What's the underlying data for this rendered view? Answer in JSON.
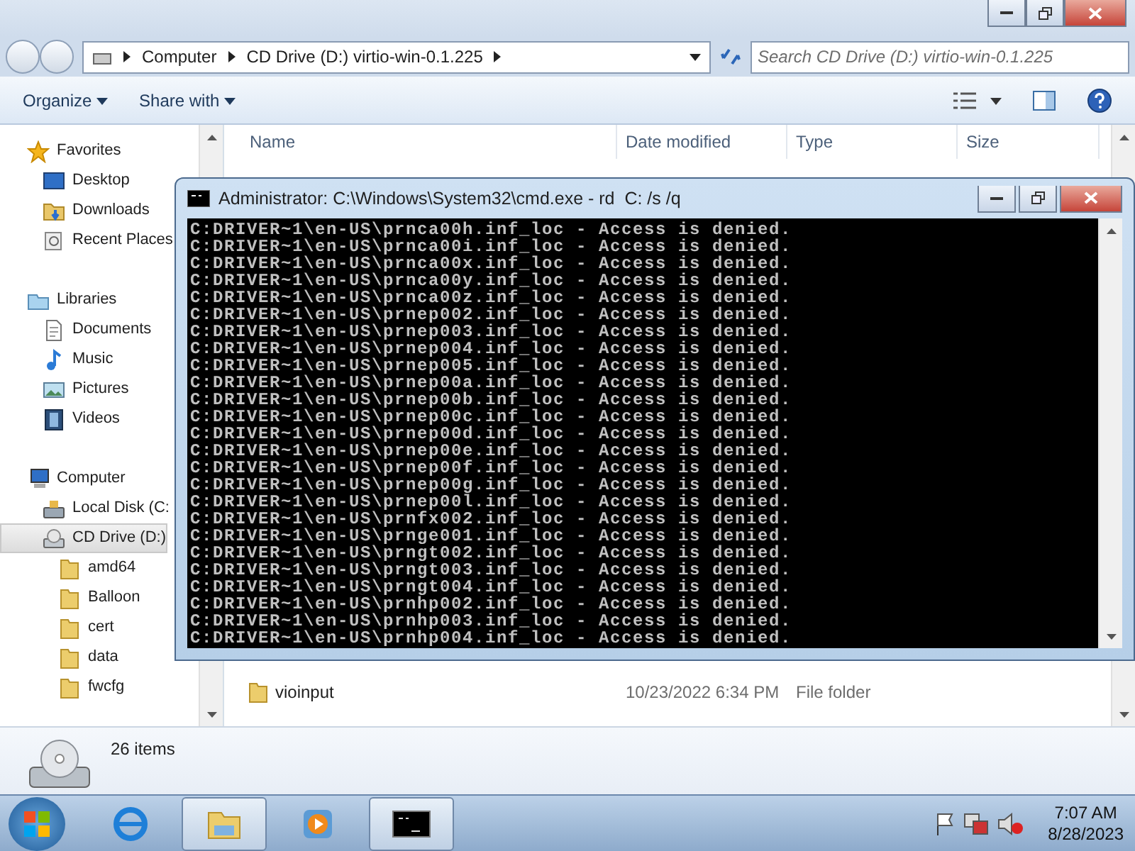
{
  "address_bar": {
    "segments": [
      "Computer",
      "CD Drive (D:) virtio-win-0.1.225"
    ]
  },
  "search": {
    "placeholder": "Search CD Drive (D:) virtio-win-0.1.225"
  },
  "toolbar": {
    "menus": [
      "Organize",
      "Share with"
    ]
  },
  "navigation": {
    "items": [
      {
        "label": "Favorites",
        "kind": "star",
        "selected": false,
        "children": [
          {
            "label": "Desktop",
            "kind": "desktop",
            "selected": false
          },
          {
            "label": "Downloads",
            "kind": "downloads",
            "selected": false
          },
          {
            "label": "Recent Places",
            "kind": "recent",
            "selected": false
          }
        ]
      },
      {
        "label": "Libraries",
        "kind": "library",
        "selected": false,
        "children": [
          {
            "label": "Documents",
            "kind": "document",
            "selected": false
          },
          {
            "label": "Music",
            "kind": "music",
            "selected": false
          },
          {
            "label": "Pictures",
            "kind": "pictures",
            "selected": false
          },
          {
            "label": "Videos",
            "kind": "videos",
            "selected": false
          }
        ]
      },
      {
        "label": "Computer",
        "kind": "computer",
        "selected": false,
        "children": [
          {
            "label": "Local Disk (C:",
            "kind": "disk",
            "selected": false
          },
          {
            "label": "CD Drive (D:)",
            "kind": "cd",
            "selected": true,
            "children": [
              {
                "label": "amd64",
                "kind": "folder",
                "selected": false
              },
              {
                "label": "Balloon",
                "kind": "folder",
                "selected": false
              },
              {
                "label": "cert",
                "kind": "folder",
                "selected": false
              },
              {
                "label": "data",
                "kind": "folder",
                "selected": false
              },
              {
                "label": "fwcfg",
                "kind": "folder",
                "selected": false
              }
            ]
          }
        ]
      }
    ]
  },
  "file_list": {
    "columns": [
      "Name",
      "Date modified",
      "Type",
      "Size"
    ],
    "rows": [
      {
        "name": "vioinput",
        "date": "10/23/2022 6:34 PM",
        "type": "File folder"
      }
    ]
  },
  "details_pane": {
    "summary": "26 items"
  },
  "console": {
    "title": "Administrator: C:\\Windows\\System32\\cmd.exe - rd  C: /s /q",
    "lines": [
      "C:DRIVER~1\\en-US\\prnca00h.inf_loc - Access is denied.",
      "C:DRIVER~1\\en-US\\prnca00i.inf_loc - Access is denied.",
      "C:DRIVER~1\\en-US\\prnca00x.inf_loc - Access is denied.",
      "C:DRIVER~1\\en-US\\prnca00y.inf_loc - Access is denied.",
      "C:DRIVER~1\\en-US\\prnca00z.inf_loc - Access is denied.",
      "C:DRIVER~1\\en-US\\prnep002.inf_loc - Access is denied.",
      "C:DRIVER~1\\en-US\\prnep003.inf_loc - Access is denied.",
      "C:DRIVER~1\\en-US\\prnep004.inf_loc - Access is denied.",
      "C:DRIVER~1\\en-US\\prnep005.inf_loc - Access is denied.",
      "C:DRIVER~1\\en-US\\prnep00a.inf_loc - Access is denied.",
      "C:DRIVER~1\\en-US\\prnep00b.inf_loc - Access is denied.",
      "C:DRIVER~1\\en-US\\prnep00c.inf_loc - Access is denied.",
      "C:DRIVER~1\\en-US\\prnep00d.inf_loc - Access is denied.",
      "C:DRIVER~1\\en-US\\prnep00e.inf_loc - Access is denied.",
      "C:DRIVER~1\\en-US\\prnep00f.inf_loc - Access is denied.",
      "C:DRIVER~1\\en-US\\prnep00g.inf_loc - Access is denied.",
      "C:DRIVER~1\\en-US\\prnep00l.inf_loc - Access is denied.",
      "C:DRIVER~1\\en-US\\prnfx002.inf_loc - Access is denied.",
      "C:DRIVER~1\\en-US\\prnge001.inf_loc - Access is denied.",
      "C:DRIVER~1\\en-US\\prngt002.inf_loc - Access is denied.",
      "C:DRIVER~1\\en-US\\prngt003.inf_loc - Access is denied.",
      "C:DRIVER~1\\en-US\\prngt004.inf_loc - Access is denied.",
      "C:DRIVER~1\\en-US\\prnhp002.inf_loc - Access is denied.",
      "C:DRIVER~1\\en-US\\prnhp003.inf_loc - Access is denied.",
      "C:DRIVER~1\\en-US\\prnhp004.inf_loc - Access is denied."
    ]
  },
  "taskbar": {
    "buttons": [
      {
        "kind": "browser",
        "active": false
      },
      {
        "kind": "explorer",
        "active": true
      },
      {
        "kind": "media",
        "active": false
      },
      {
        "kind": "console",
        "active": true
      }
    ],
    "clock": {
      "time": "7:07 AM",
      "date": "8/28/2023"
    }
  }
}
